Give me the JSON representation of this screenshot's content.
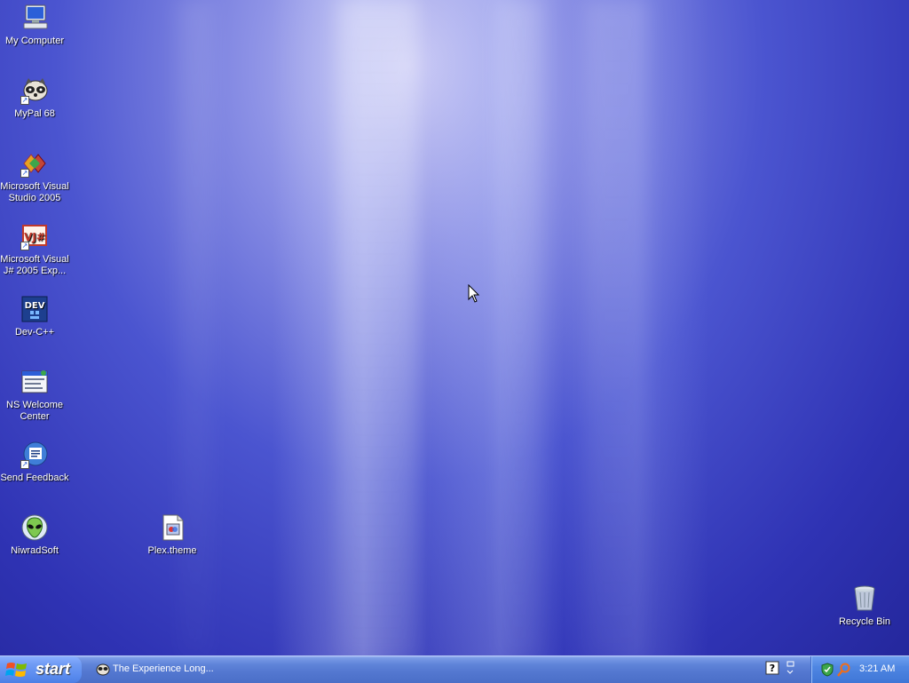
{
  "desktop": {
    "icons": [
      {
        "label": "My Computer",
        "icon": "my-computer-icon"
      },
      {
        "label": "MyPal 68",
        "icon": "mypal-icon"
      },
      {
        "label": "Microsoft Visual Studio 2005",
        "icon": "visual-studio-icon"
      },
      {
        "label": "Microsoft Visual J# 2005 Exp...",
        "icon": "vjsharp-icon"
      },
      {
        "label": "Dev-C++",
        "icon": "dev-cpp-icon"
      },
      {
        "label": "NS Welcome Center",
        "icon": "welcome-center-icon"
      },
      {
        "label": "Send Feedback",
        "icon": "send-feedback-icon"
      },
      {
        "label": "NiwradSoft",
        "icon": "niwradsoft-icon"
      },
      {
        "label": "Plex.theme",
        "icon": "theme-file-icon"
      },
      {
        "label": "Recycle Bin",
        "icon": "recycle-bin-icon"
      }
    ]
  },
  "taskbar": {
    "start_label": "start",
    "task_label": "The Experience Long...",
    "clock": "3:21 AM"
  },
  "colors": {
    "taskbar": "#5377d0",
    "start": "#5b8cef",
    "tray": "#4f86e2"
  }
}
